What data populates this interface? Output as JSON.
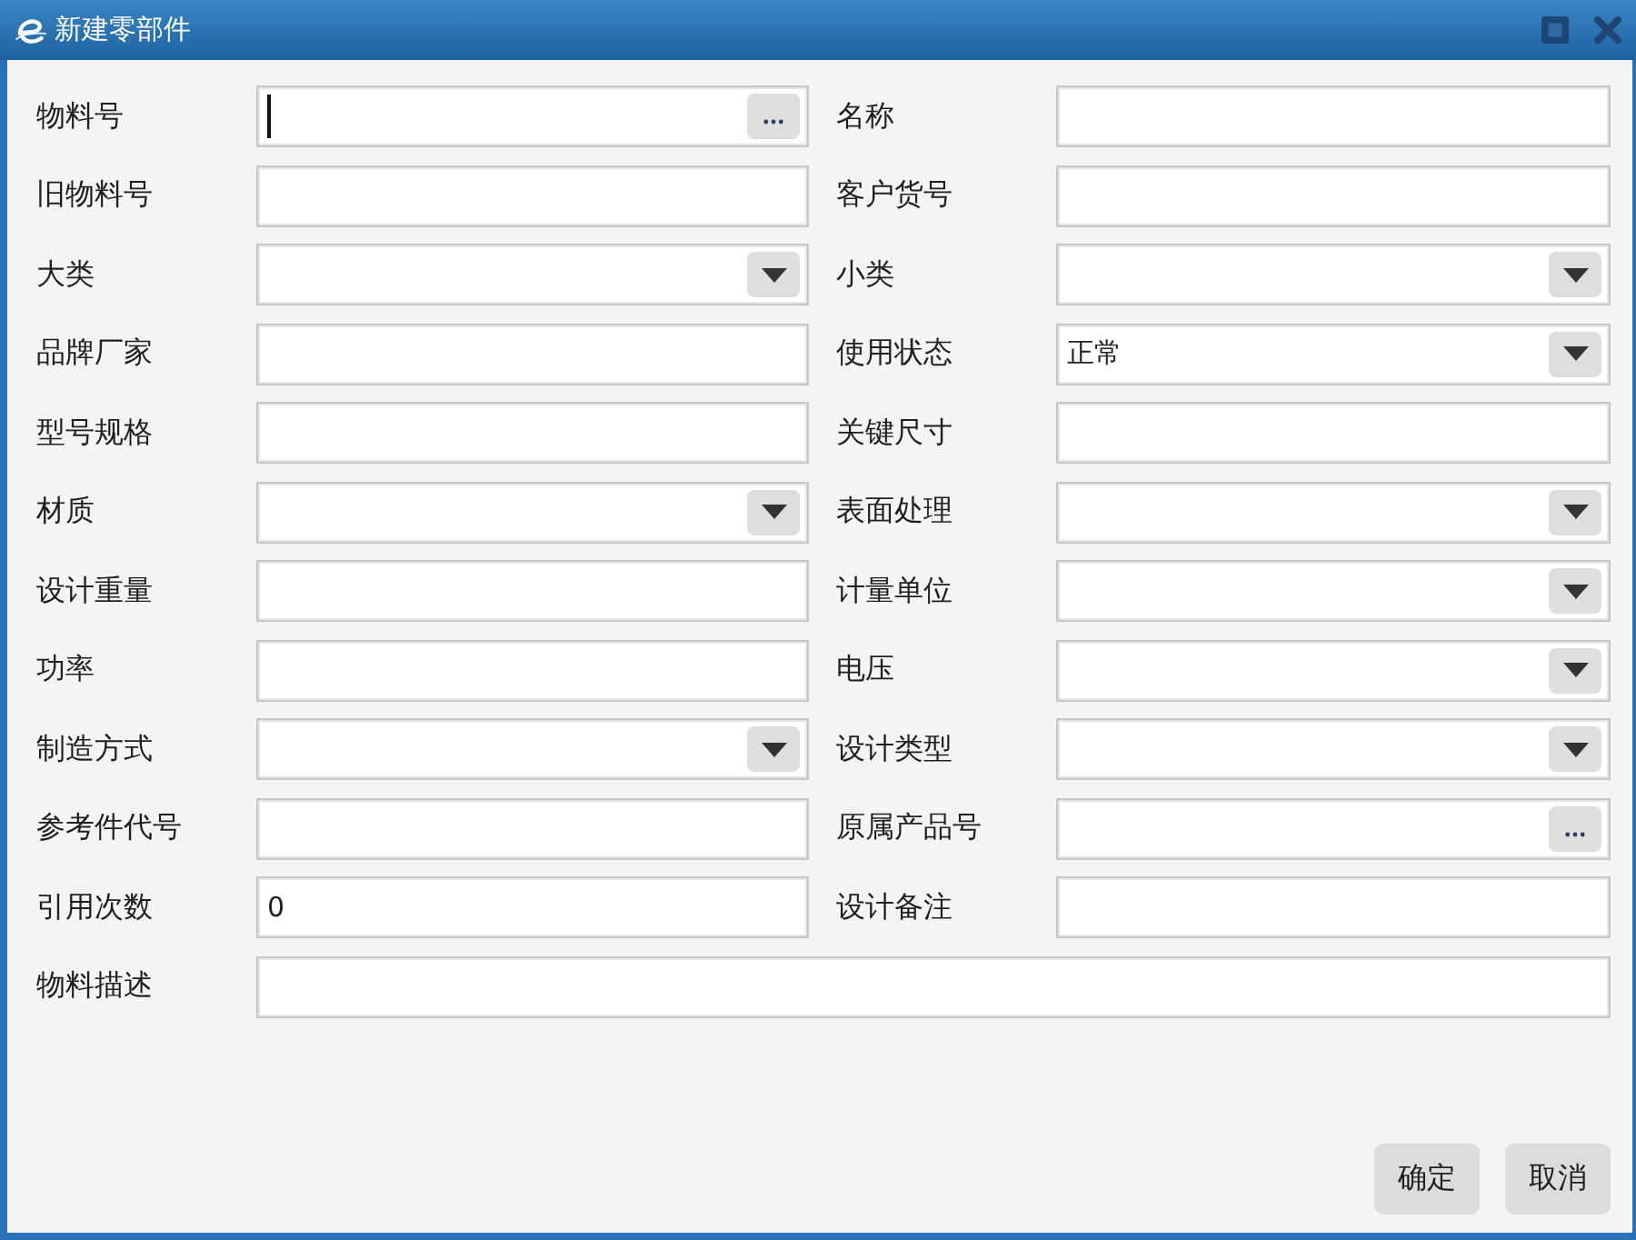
{
  "window": {
    "title": "新建零部件"
  },
  "form": {
    "rows": [
      {
        "fields": [
          {
            "label": "物料号",
            "kind": "lookup",
            "focused": true
          },
          {
            "label": "名称",
            "kind": "text",
            "focused": false
          }
        ]
      },
      {
        "fields": [
          {
            "label": "旧物料号",
            "kind": "text",
            "focused": false
          },
          {
            "label": "客户货号",
            "kind": "text",
            "focused": false
          }
        ]
      },
      {
        "fields": [
          {
            "label": "大类",
            "kind": "select",
            "focused": false
          },
          {
            "label": "小类",
            "kind": "select",
            "focused": false
          }
        ]
      },
      {
        "fields": [
          {
            "label": "品牌厂家",
            "kind": "text",
            "focused": false
          },
          {
            "label": "使用状态",
            "kind": "select",
            "value": "正常",
            "focused": false
          }
        ]
      },
      {
        "fields": [
          {
            "label": "型号规格",
            "kind": "text",
            "focused": false
          },
          {
            "label": "关键尺寸",
            "kind": "text",
            "focused": false
          }
        ]
      },
      {
        "fields": [
          {
            "label": "材质",
            "kind": "select",
            "focused": false
          },
          {
            "label": "表面处理",
            "kind": "select",
            "focused": false
          }
        ]
      },
      {
        "fields": [
          {
            "label": "设计重量",
            "kind": "text",
            "focused": false
          },
          {
            "label": "计量单位",
            "kind": "select",
            "focused": false
          }
        ]
      },
      {
        "fields": [
          {
            "label": "功率",
            "kind": "text",
            "focused": false
          },
          {
            "label": "电压",
            "kind": "select",
            "focused": false
          }
        ]
      },
      {
        "fields": [
          {
            "label": "制造方式",
            "kind": "select",
            "focused": false
          },
          {
            "label": "设计类型",
            "kind": "select",
            "focused": false
          }
        ]
      },
      {
        "fields": [
          {
            "label": "参考件代号",
            "kind": "text",
            "focused": false
          },
          {
            "label": "原属产品号",
            "kind": "lookup",
            "focused": false
          }
        ]
      },
      {
        "fields": [
          {
            "label": "引用次数",
            "kind": "text",
            "value": "0",
            "focused": false
          },
          {
            "label": "设计备注",
            "kind": "text",
            "focused": false
          }
        ]
      },
      {
        "fields": [
          {
            "label": "物料描述",
            "kind": "text",
            "focused": false
          }
        ]
      }
    ]
  },
  "buttons": [
    {
      "label": "确定"
    },
    {
      "label": "取消"
    }
  ]
}
